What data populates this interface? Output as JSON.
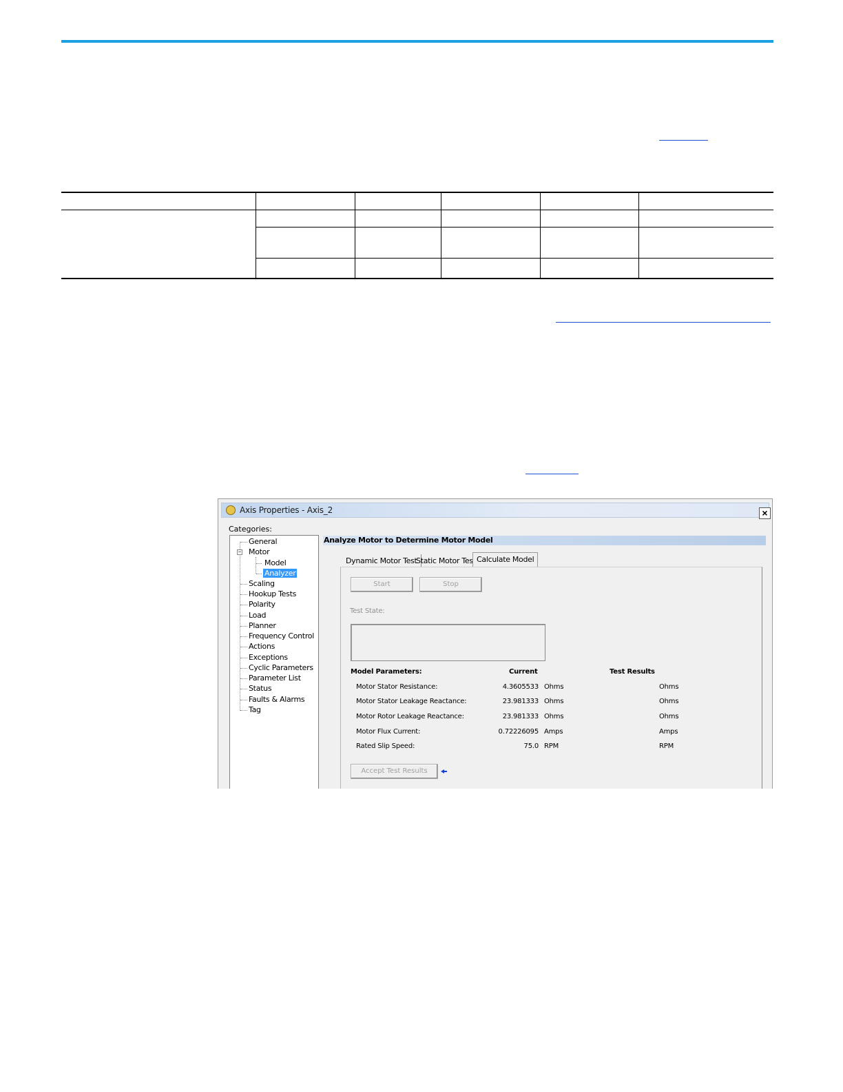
{
  "dialog": {
    "title": "Axis Properties - Axis_2",
    "close_label": "×",
    "categories_label": "Categories:",
    "tree": {
      "general": "General",
      "motor": "Motor",
      "model": "Model",
      "analyzer": "Analyzer",
      "scaling": "Scaling",
      "hookup_tests": "Hookup Tests",
      "polarity": "Polarity",
      "load": "Load",
      "planner": "Planner",
      "frequency_control": "Frequency Control",
      "actions": "Actions",
      "exceptions": "Exceptions",
      "cyclic_parameters": "Cyclic Parameters",
      "parameter_list": "Parameter List",
      "status": "Status",
      "faults_alarms": "Faults & Alarms",
      "tag": "Tag"
    },
    "panel_header": "Analyze Motor to Determine Motor Model",
    "tabs": {
      "dynamic": "Dynamic Motor Test",
      "static": "Static Motor Test",
      "calculate": "Calculate Model"
    },
    "buttons": {
      "start": "Start",
      "stop": "Stop",
      "accept": "Accept Test Results"
    },
    "test_state_label": "Test State:",
    "headers": {
      "model_parameters": "Model Parameters:",
      "current": "Current",
      "test_results": "Test Results"
    },
    "rows": [
      {
        "label": "Motor Stator Resistance:",
        "value": "4.3605533",
        "unit": "Ohms",
        "result_unit": "Ohms"
      },
      {
        "label": "Motor Stator Leakage Reactance:",
        "value": "23.981333",
        "unit": "Ohms",
        "result_unit": "Ohms"
      },
      {
        "label": "Motor Rotor Leakage Reactance:",
        "value": "23.981333",
        "unit": "Ohms",
        "result_unit": "Ohms"
      },
      {
        "label": "Motor Flux Current:",
        "value": "0.72226095",
        "unit": "Amps",
        "result_unit": "Amps"
      },
      {
        "label": "Rated Slip Speed:",
        "value": "75.0",
        "unit": "RPM",
        "result_unit": "RPM"
      }
    ],
    "arrow_icon": "left-arrow-icon"
  },
  "colors": {
    "accent_bar": "#1ba1e2",
    "link": "#1a4fd6",
    "selection": "#3399ff"
  }
}
